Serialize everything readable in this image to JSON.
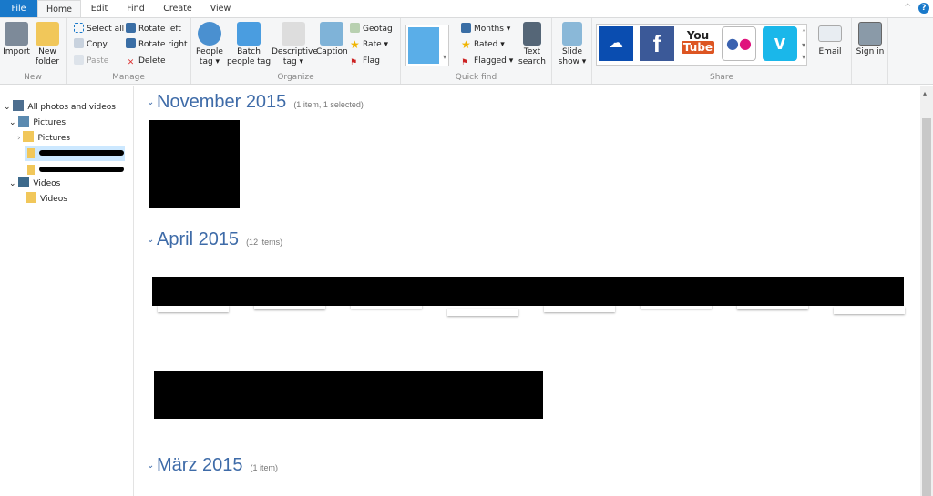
{
  "tabs": [
    "File",
    "Home",
    "Edit",
    "Find",
    "Create",
    "View"
  ],
  "ribbon": {
    "new": {
      "label": "New",
      "import": "Import",
      "new_folder": "New folder"
    },
    "manage": {
      "label": "Manage",
      "select_all": "Select all",
      "copy": "Copy",
      "paste": "Paste",
      "rotate_left": "Rotate left",
      "rotate_right": "Rotate right",
      "delete": "Delete"
    },
    "organize": {
      "label": "Organize",
      "people_tag": "People tag",
      "batch_people_tag": "Batch people tag",
      "descriptive_tag": "Descriptive tag",
      "caption": "Caption",
      "geotag": "Geotag",
      "rate": "Rate",
      "flag": "Flag"
    },
    "quick_find": {
      "label": "Quick find",
      "months": "Months",
      "rated": "Rated",
      "flagged": "Flagged",
      "text_search": "Text search"
    },
    "slideshow": "Slide show",
    "share": {
      "label": "Share",
      "services": [
        "OneDrive",
        "Facebook",
        "YouTube",
        "Flickr",
        "Vimeo"
      ],
      "email": "Email"
    },
    "sign_in": "Sign in"
  },
  "sidebar": {
    "all": "All photos and videos",
    "pictures": "Pictures",
    "pictures_sub": "Pictures",
    "videos": "Videos",
    "videos_sub": "Videos"
  },
  "groups": [
    {
      "title": "November 2015",
      "meta": "(1 item, 1 selected)"
    },
    {
      "title": "April 2015",
      "meta": "(12 items)"
    },
    {
      "title": "März 2015",
      "meta": "(1 item)"
    }
  ],
  "colors": {
    "accent": "#1979ca",
    "heading": "#3e6ba8"
  }
}
